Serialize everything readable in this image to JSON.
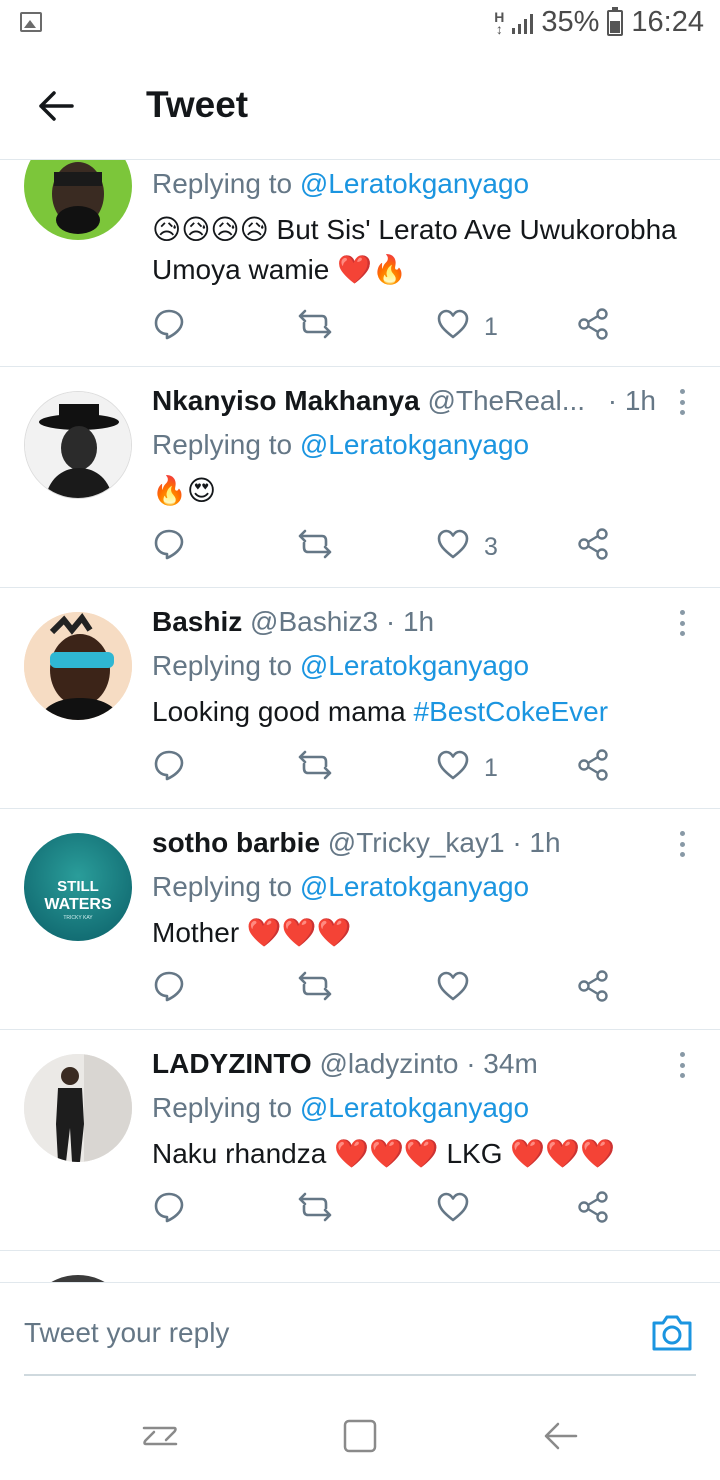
{
  "status_bar": {
    "network": "H",
    "battery": "35%",
    "time": "16:24"
  },
  "header": {
    "title": "Tweet"
  },
  "tweets": [
    {
      "name": "",
      "handle": "",
      "time": "",
      "replying_label": "Replying to ",
      "replying_to": "@Leratokganyago",
      "text": "😥😥😥😥 But Sis' Lerato Ave Uwukorobha Umoya wamie ❤️🔥",
      "hashtag": "",
      "likes": "1"
    },
    {
      "name": "Nkanyiso Makhanya",
      "handle": "@TheReal...",
      "time": "· 1h",
      "replying_label": "Replying to ",
      "replying_to": "@Leratokganyago",
      "text": "🔥😍",
      "hashtag": "",
      "likes": "3"
    },
    {
      "name": "Bashiz",
      "handle": "@Bashiz3",
      "time": "· 1h",
      "replying_label": "Replying to ",
      "replying_to": "@Leratokganyago",
      "text": "Looking good mama ",
      "hashtag": "#BestCokeEver",
      "likes": "1"
    },
    {
      "name": "sotho barbie",
      "handle": "@Tricky_kay1",
      "time": "· 1h",
      "replying_label": "Replying to ",
      "replying_to": "@Leratokganyago",
      "text": "Mother ❤️❤️❤️",
      "hashtag": "",
      "likes": "",
      "avatar_text": {
        "line1": "STILL",
        "line2": "WATERS",
        "line3": "TRICKY KAY"
      }
    },
    {
      "name": "LADYZINTO",
      "handle": "@ladyzinto",
      "time": "· 34m",
      "replying_label": "Replying to ",
      "replying_to": "@Leratokganyago",
      "text": "Naku rhandza ❤️❤️❤️ LKG ❤️❤️❤️",
      "hashtag": "",
      "likes": ""
    }
  ],
  "composer": {
    "placeholder": "Tweet your reply"
  },
  "colors": {
    "accent": "#1b95e0",
    "muted": "#657786",
    "divider": "#e1e8ed"
  }
}
